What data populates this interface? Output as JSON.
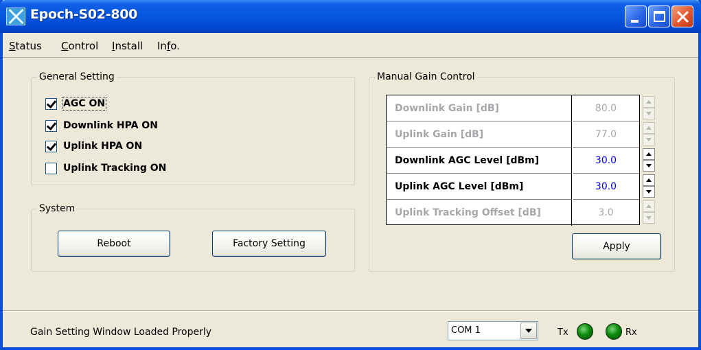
{
  "window": {
    "title": "Epoch-S02-800"
  },
  "menu": [
    {
      "label": "Status",
      "accel": "S",
      "rest": "tatus"
    },
    {
      "label": "Control",
      "accel": "C",
      "rest": "ontrol"
    },
    {
      "label": "Install",
      "accel": "I",
      "rest": "nstall"
    },
    {
      "label": "Info.",
      "pre": "In",
      "accel": "f",
      "rest": "o."
    }
  ],
  "general_setting": {
    "title": "General Setting",
    "options": [
      {
        "label": "AGC ON",
        "checked": true
      },
      {
        "label": "Downlink HPA ON",
        "checked": true
      },
      {
        "label": "Uplink HPA ON",
        "checked": true
      },
      {
        "label": "Uplink Tracking ON",
        "checked": false
      }
    ]
  },
  "system": {
    "title": "System",
    "reboot_label": "Reboot",
    "factory_label": "Factory Setting"
  },
  "manual_gain": {
    "title": "Manual Gain Control",
    "rows": [
      {
        "label": "Downlink Gain [dB]",
        "value": "80.0",
        "enabled": false
      },
      {
        "label": "Uplink Gain [dB]",
        "value": "77.0",
        "enabled": false
      },
      {
        "label": "Downlink AGC Level [dBm]",
        "value": "30.0",
        "enabled": true
      },
      {
        "label": "Uplink AGC Level [dBm]",
        "value": "30.0",
        "enabled": true
      },
      {
        "label": "Uplink Tracking Offset [dB]",
        "value": "3.0",
        "enabled": false
      }
    ],
    "apply_label": "Apply"
  },
  "statusbar": {
    "message": "Gain Setting Window Loaded Properly",
    "port": "COM 1",
    "tx_label": "Tx",
    "rx_label": "Rx"
  },
  "colors": {
    "titlebar": "#0556e1",
    "window_bg": "#ece9d8",
    "active_value": "#0000ee",
    "disabled_text": "#a7a6aa",
    "led_green": "#0b8a0b"
  }
}
